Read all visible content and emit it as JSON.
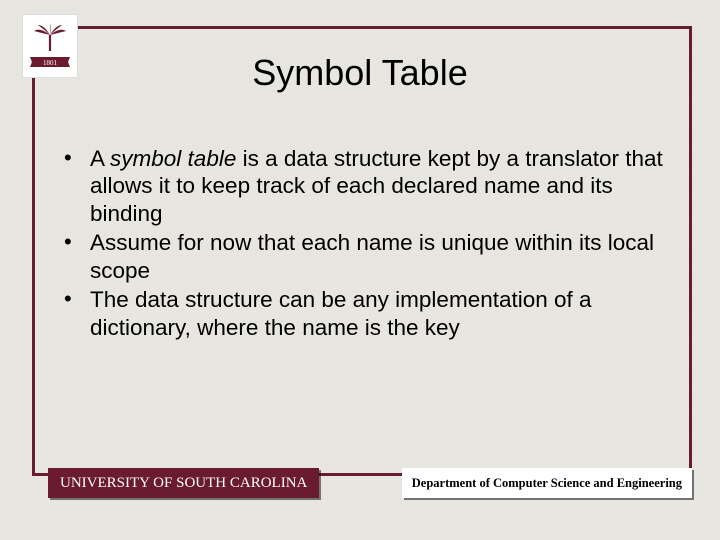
{
  "title": "Symbol Table",
  "bullets": {
    "b1_em": "symbol table",
    "b1_pre": "A ",
    "b1_post": " is a data structure kept by a translator that allows it to keep track of each declared name and its binding",
    "b2": "Assume for now that each name is unique within its local scope",
    "b3": "The data structure can be any implementation of a dictionary, where the name is the key"
  },
  "footer": {
    "university": "UNIVERSITY OF SOUTH CAROLINA",
    "department": "Department of Computer Science and Engineering"
  },
  "logo": {
    "alt": "University of South Carolina logo",
    "year": "1801"
  },
  "colors": {
    "garnet": "#6b1b2e"
  }
}
